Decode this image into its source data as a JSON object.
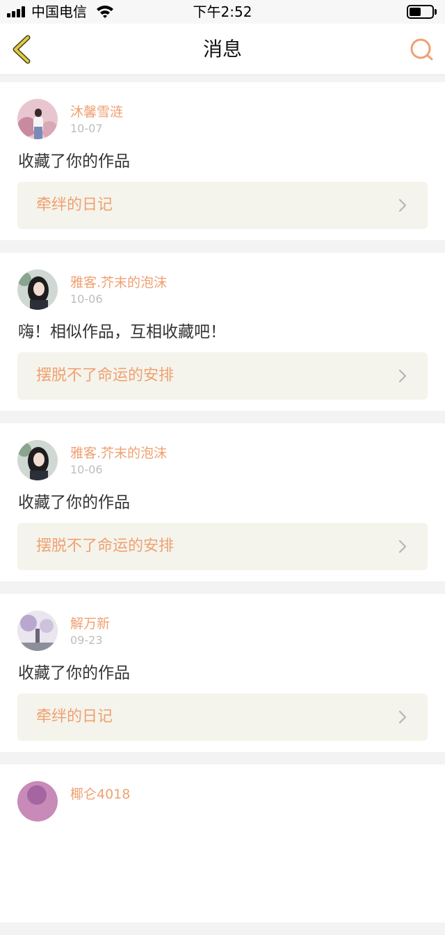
{
  "status_bar": {
    "carrier": "中国电信",
    "time": "下午2:52",
    "battery_level": 0.5
  },
  "nav": {
    "title": "消息",
    "back_icon": "chevron-left-icon",
    "search_icon": "search-icon"
  },
  "colors": {
    "accent": "#f0a070",
    "back_icon": "#d8c23c",
    "card_link_bg": "#f4f4ec",
    "page_bg": "#f3f3f3"
  },
  "messages": [
    {
      "username": "沐馨雪涟",
      "date": "10-07",
      "text": "收藏了你的作品",
      "work_title": "牵绊的日记"
    },
    {
      "username": "雅客.芥末的泡沫",
      "date": "10-06",
      "text": "嗨！相似作品，互相收藏吧！",
      "work_title": "摆脱不了命运的安排"
    },
    {
      "username": "雅客.芥末的泡沫",
      "date": "10-06",
      "text": "收藏了你的作品",
      "work_title": "摆脱不了命运的安排"
    },
    {
      "username": "解万新",
      "date": "09-23",
      "text": "收藏了你的作品",
      "work_title": "牵绊的日记"
    },
    {
      "username": "椰仑4018",
      "date": "",
      "text": "",
      "work_title": ""
    }
  ]
}
